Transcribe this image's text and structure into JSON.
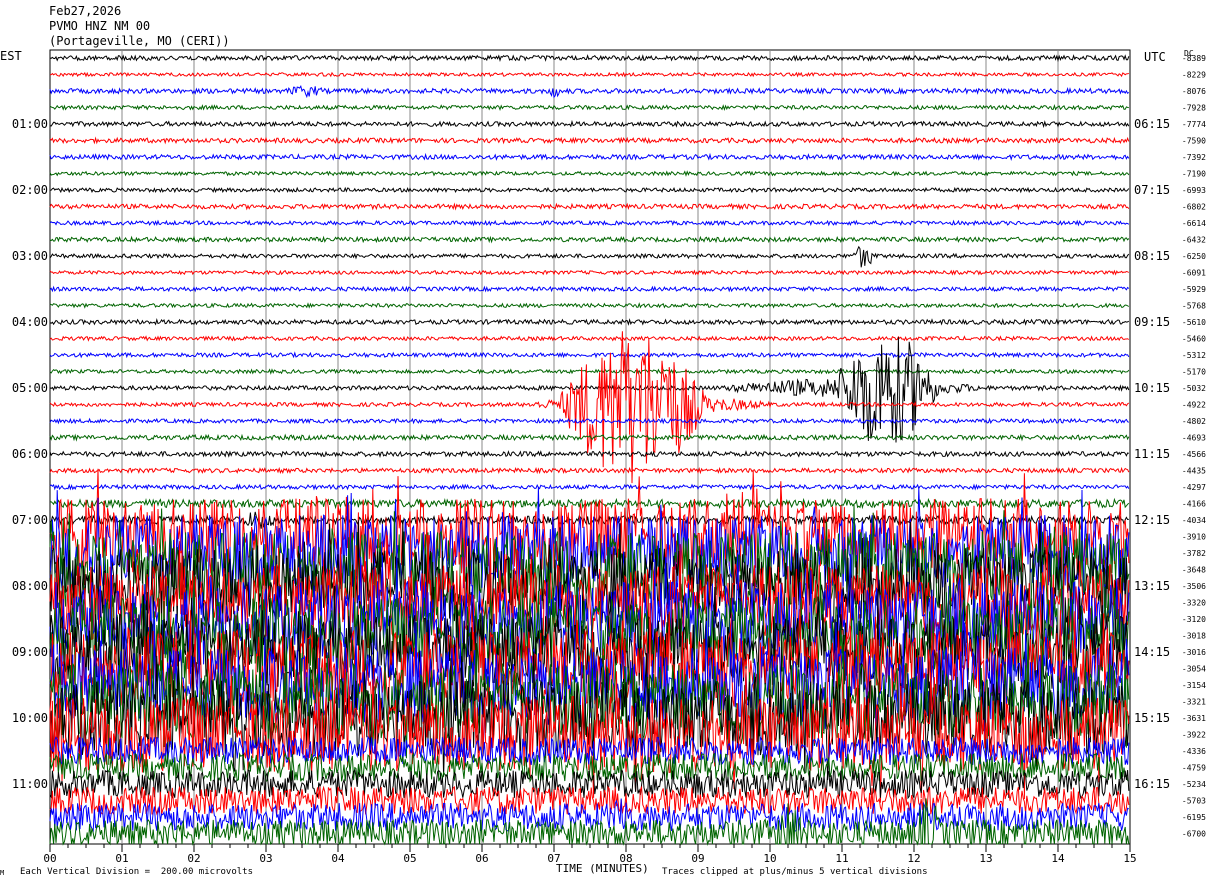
{
  "header": {
    "date": "Feb27,2026",
    "station": "PVMO HNZ NM 00",
    "location": "(Portageville, MO (CERI))"
  },
  "left_zone": "EST",
  "right_zone": "UTC",
  "dc_label": "DC",
  "footer": {
    "scale_note": "Each Vertical Division =  200.00 microvolts",
    "clip_note": "Traces clipped at plus/minus 5 vertical divisions",
    "corner_mark": "M"
  },
  "chart_data": {
    "type": "line",
    "title": "",
    "xlabel": "TIME (MINUTES)",
    "ylabel": "",
    "xlim": [
      0,
      15
    ],
    "x_ticks": [
      "00",
      "01",
      "02",
      "03",
      "04",
      "05",
      "06",
      "07",
      "08",
      "09",
      "10",
      "11",
      "12",
      "13",
      "14",
      "15"
    ],
    "grid": "vertical lines every minute",
    "trace_count": 48,
    "trace_colors": [
      "#000000",
      "#ff0000",
      "#0000ff",
      "#006400"
    ],
    "left_time_labels": [
      "01:00",
      "02:00",
      "03:00",
      "04:00",
      "05:00",
      "06:00",
      "07:00",
      "08:00",
      "09:00",
      "10:00",
      "11:00"
    ],
    "right_time_labels": [
      "06:15",
      "07:15",
      "08:15",
      "09:15",
      "10:15",
      "11:15",
      "12:15",
      "13:15",
      "14:15",
      "15:15",
      "16:15"
    ],
    "dc_offsets": [
      "-8389",
      "-8229",
      "-8076",
      "-7928",
      "-7774",
      "-7590",
      "-7392",
      "-7190",
      "-6993",
      "-6802",
      "-6614",
      "-6432",
      "-6250",
      "-6091",
      "-5929",
      "-5768",
      "-5610",
      "-5460",
      "-5312",
      "-5170",
      "-5032",
      "-4922",
      "-4802",
      "-4693",
      "-4566",
      "-4435",
      "-4297",
      "-4166",
      "-4034",
      "-3910",
      "-3782",
      "-3648",
      "-3506",
      "-3320",
      "-3120",
      "-3018",
      "-3016",
      "-3054",
      "-3154",
      "-3321",
      "-3631",
      "-3922",
      "-4336",
      "-4759",
      "-5234",
      "-5703",
      "-6195",
      "-6700"
    ]
  }
}
